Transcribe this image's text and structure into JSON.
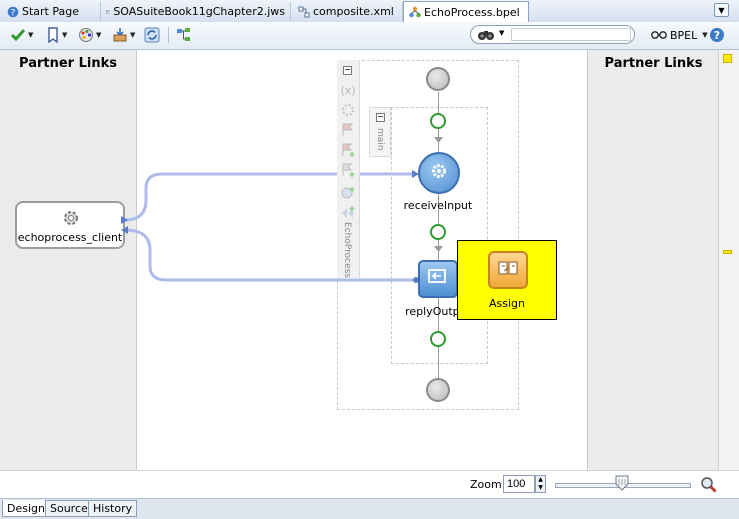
{
  "tabs": [
    {
      "label": "Start Page",
      "icon": "help-icon",
      "active": false
    },
    {
      "label": "SOASuiteBook11gChapter2.jws",
      "icon": "project-icon",
      "active": false
    },
    {
      "label": "composite.xml",
      "icon": "composite-icon",
      "active": false
    },
    {
      "label": "EchoProcess.bpel",
      "icon": "bpel-icon",
      "active": true
    }
  ],
  "toolbar": {
    "validate_icon": "checkmark-icon",
    "bookmark_icon": "bookmark-icon",
    "palette_icon": "palette-icon",
    "deploy_icon": "deploy-icon",
    "refresh_icon": "refresh-icon",
    "tree_icon": "tree-icon",
    "search_icon": "binoculars-icon",
    "search_value": "",
    "view_label": "BPEL",
    "view_icon": "glasses-icon",
    "help_icon": "help-icon"
  },
  "left_panel": {
    "title": "Partner Links",
    "partner_link": "echoprocess_client",
    "partner_link_icon": "gear-icon"
  },
  "right_panel": {
    "title": "Partner Links"
  },
  "process": {
    "name": "EchoProcess",
    "scope_label": "main",
    "activities": [
      {
        "name": "receiveInput",
        "icon": "gear-icon",
        "color": "#5d9ad8"
      },
      {
        "name": "replyOutput",
        "icon": "reply-icon",
        "color": "#5d9ad8"
      }
    ],
    "side_palette_icons": [
      "variables-icon",
      "correlation-icon",
      "flag-icon",
      "add-flag-icon",
      "edit-flag-icon",
      "alarm-icon",
      "double-flag-icon"
    ]
  },
  "drag_tooltip": {
    "label": "Assign",
    "icon": "assign-icon",
    "bg_color": "#ffff00"
  },
  "zoom": {
    "label": "Zoom:",
    "value": "100",
    "slider_level": 0.5,
    "zoom_icon": "magnifier-icon"
  },
  "bottom_tabs": [
    {
      "label": "Design",
      "active": true
    },
    {
      "label": "Source",
      "active": false
    },
    {
      "label": "History",
      "active": false
    }
  ]
}
